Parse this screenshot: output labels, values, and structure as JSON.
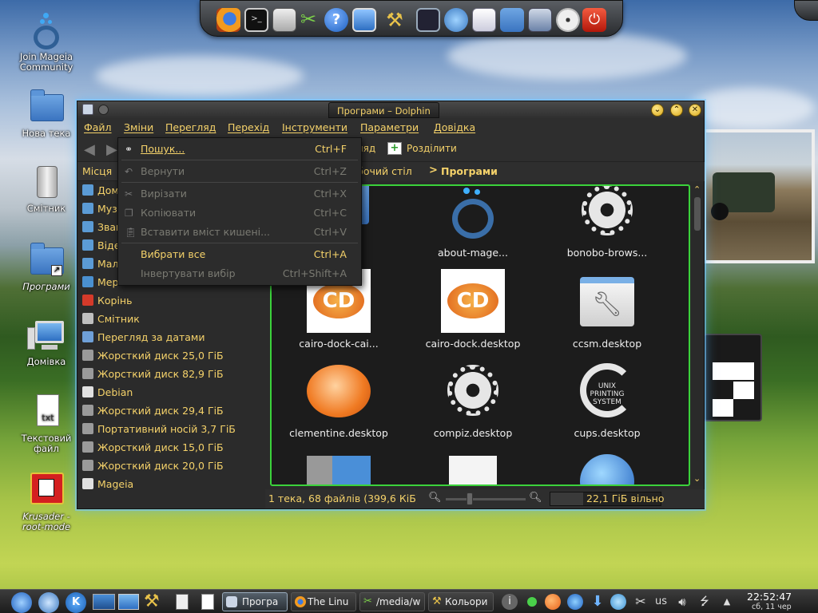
{
  "desktop": {
    "icons": [
      {
        "label": "Join Mageia Community",
        "icon": "mageia-icon"
      },
      {
        "label": "Нова тека",
        "icon": "folder-icon"
      },
      {
        "label": "Смітник",
        "icon": "trash-icon"
      },
      {
        "label": "Програми",
        "icon": "folder-link-icon"
      },
      {
        "label": "Домівка",
        "icon": "computer-icon"
      },
      {
        "label": "Текстовий файл",
        "icon": "text-file-icon"
      },
      {
        "label": "Krusader - root-mode",
        "icon": "krusader-icon"
      }
    ]
  },
  "top_dock": {
    "items": [
      "firefox-icon",
      "terminal-icon",
      "calculator-icon",
      "scissors-icon",
      "help-icon",
      "monitor-icon",
      "tools-icon",
      "window-icon",
      "update-icon",
      "documents-icon",
      "folder-icon",
      "install-icon",
      "disc-icon",
      "power-icon"
    ]
  },
  "window": {
    "title": "Програми – Dolphin",
    "menubar": [
      "Файл",
      "Зміни",
      "Перегляд",
      "Перехід",
      "Інструменти",
      "Параметри",
      "Довідка"
    ],
    "toolbar": {
      "split_label": "Розділити",
      "partial_label": "ляд"
    },
    "places_header": "Місця",
    "places": [
      {
        "label": "Домівка",
        "color": "#5b9bd5"
      },
      {
        "label": "Музика",
        "color": "#5b9bd5"
      },
      {
        "label": "Звантаження",
        "color": "#5b9bd5"
      },
      {
        "label": "Відео",
        "color": "#5b9bd5"
      },
      {
        "label": "Малюнки",
        "color": "#5b9bd5"
      },
      {
        "label": "Мережа",
        "color": "#4a90d0"
      },
      {
        "label": "Корінь",
        "color": "#d43a2a"
      },
      {
        "label": "Смітник",
        "color": "#bfbfbf"
      },
      {
        "label": "Перегляд за датами",
        "color": "#6fa0d8"
      },
      {
        "label": "Жорсткий диск 25,0 ГіБ",
        "color": "#9a9a9a"
      },
      {
        "label": "Жорсткий диск 82,9 ГіБ",
        "color": "#9a9a9a"
      },
      {
        "label": "Debian",
        "color": "#e0e0e0"
      },
      {
        "label": "Жорсткий диск 29,4 ГіБ",
        "color": "#9a9a9a"
      },
      {
        "label": "Портативний носій 3,7 ГіБ",
        "color": "#9a9a9a"
      },
      {
        "label": "Жорсткий диск 15,0 ГіБ",
        "color": "#9a9a9a"
      },
      {
        "label": "Жорсткий диск 20,0 ГіБ",
        "color": "#9a9a9a"
      },
      {
        "label": "Mageia",
        "color": "#e0e0e0"
      }
    ],
    "breadcrumb": {
      "parent": "Робочий стіл",
      "separator": ">",
      "current": "Програми"
    },
    "files": [
      {
        "name": "",
        "icon": "folder-icon"
      },
      {
        "name": "about-mage...",
        "icon": "mageia-icon"
      },
      {
        "name": "bonobo-brows...",
        "icon": "gear-icon"
      },
      {
        "name": "cairo-dock-cai...",
        "icon": "cairo-dock-icon"
      },
      {
        "name": "cairo-dock.desktop",
        "icon": "cairo-dock-icon"
      },
      {
        "name": "ccsm.desktop",
        "icon": "ccsm-icon"
      },
      {
        "name": "clementine.desktop",
        "icon": "clementine-icon"
      },
      {
        "name": "compiz.desktop",
        "icon": "gear-icon"
      },
      {
        "name": "cups.desktop",
        "icon": "cups-icon"
      },
      {
        "name": "",
        "icon": "app-icon"
      },
      {
        "name": "",
        "icon": "document-icon"
      },
      {
        "name": "",
        "icon": "globe-icon"
      }
    ],
    "status": {
      "summary": "1 тека, 68 файлів (399,6 КіБ)",
      "free": "22,1 ГіБ вільно"
    }
  },
  "edit_menu": {
    "items": [
      {
        "label": "Пошук...",
        "shortcut": "Ctrl+F",
        "enabled": true,
        "icon": "binoculars-icon"
      },
      {
        "label": "Вернути",
        "shortcut": "Ctrl+Z",
        "enabled": false,
        "icon": "undo-icon"
      },
      {
        "label": "Вирізати",
        "shortcut": "Ctrl+X",
        "enabled": false,
        "icon": "cut-icon"
      },
      {
        "label": "Копіювати",
        "shortcut": "Ctrl+C",
        "enabled": false,
        "icon": "copy-icon"
      },
      {
        "label": "Вставити вміст кишені...",
        "shortcut": "Ctrl+V",
        "enabled": false,
        "icon": "paste-icon"
      },
      {
        "label": "Вибрати все",
        "shortcut": "Ctrl+A",
        "enabled": true,
        "icon": ""
      },
      {
        "label": "Інвертувати вибір",
        "shortcut": "Ctrl+Shift+A",
        "enabled": false,
        "icon": ""
      }
    ]
  },
  "taskbar": {
    "tasks": [
      "Програ",
      "The Linu",
      "/media/w",
      "Кольори"
    ],
    "keyboard": "us",
    "clock": {
      "time": "22:52:47",
      "date": "сб, 11 чер"
    }
  },
  "colors": {
    "accent": "#f5d26a",
    "focus_border": "#3bd23b",
    "window_bg": "#2b2b2b"
  }
}
